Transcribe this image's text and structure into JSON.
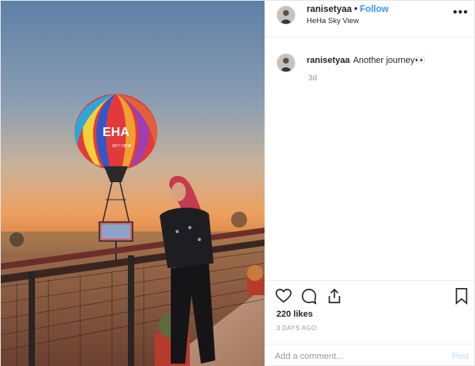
{
  "post": {
    "username": "ranisetyaa",
    "separator": "•",
    "follow_label": "Follow",
    "location": "HeHa Sky View",
    "more_icon": "more-options-icon",
    "caption_text": "Another journey👀",
    "caption_time": "3d",
    "likes": "220 likes",
    "date": "3 DAYS AGO",
    "comment_placeholder": "Add a comment...",
    "post_label": "Post",
    "balloon_text": "EHA",
    "balloon_subtext": "SKY VIEW"
  },
  "icons": {
    "like": "heart-icon",
    "comment": "comment-icon",
    "share": "share-icon",
    "save": "bookmark-icon"
  },
  "colors": {
    "follow": "#3897f0",
    "post_disabled": "#b3dbff",
    "border": "#efefef",
    "muted": "#999999"
  }
}
